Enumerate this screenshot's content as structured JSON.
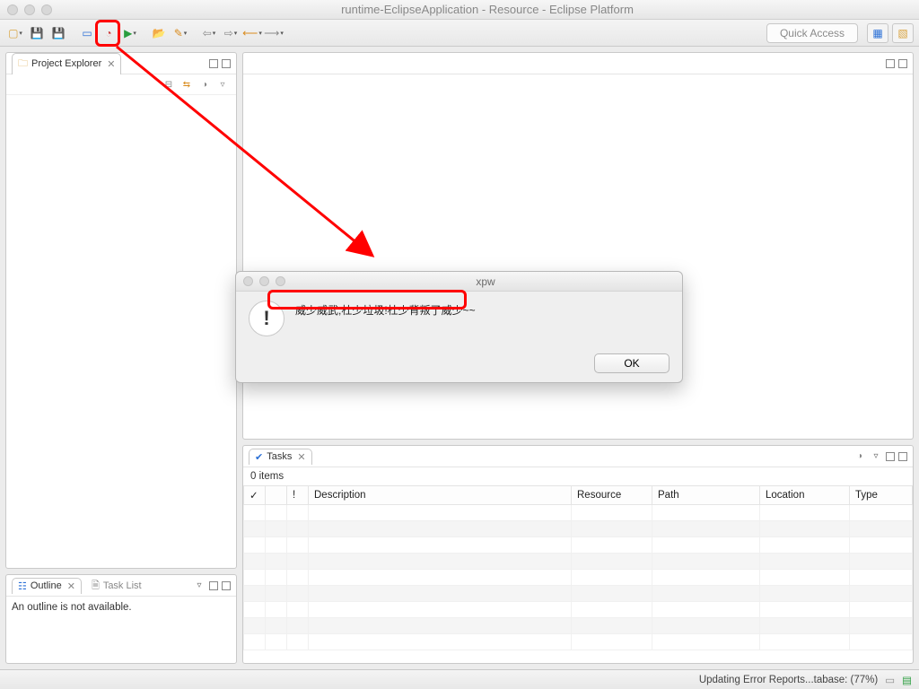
{
  "window": {
    "title": "runtime-EclipseApplication - Resource - Eclipse Platform"
  },
  "toolbar": {
    "quick_access": "Quick Access"
  },
  "views": {
    "project_explorer": {
      "title": "Project Explorer"
    },
    "outline": {
      "title": "Outline",
      "empty_text": "An outline is not available."
    },
    "task_list": {
      "title": "Task List"
    },
    "tasks": {
      "title": "Tasks",
      "count_label": "0 items",
      "columns": [
        "✓",
        "",
        "!",
        "Description",
        "Resource",
        "Path",
        "Location",
        "Type"
      ]
    }
  },
  "status": {
    "job": "Updating Error Reports...tabase: (77%)"
  },
  "dialog": {
    "title": "xpw",
    "message": "威少威武,杜少垃圾!杜少背叛了威少~~",
    "ok_label": "OK"
  }
}
